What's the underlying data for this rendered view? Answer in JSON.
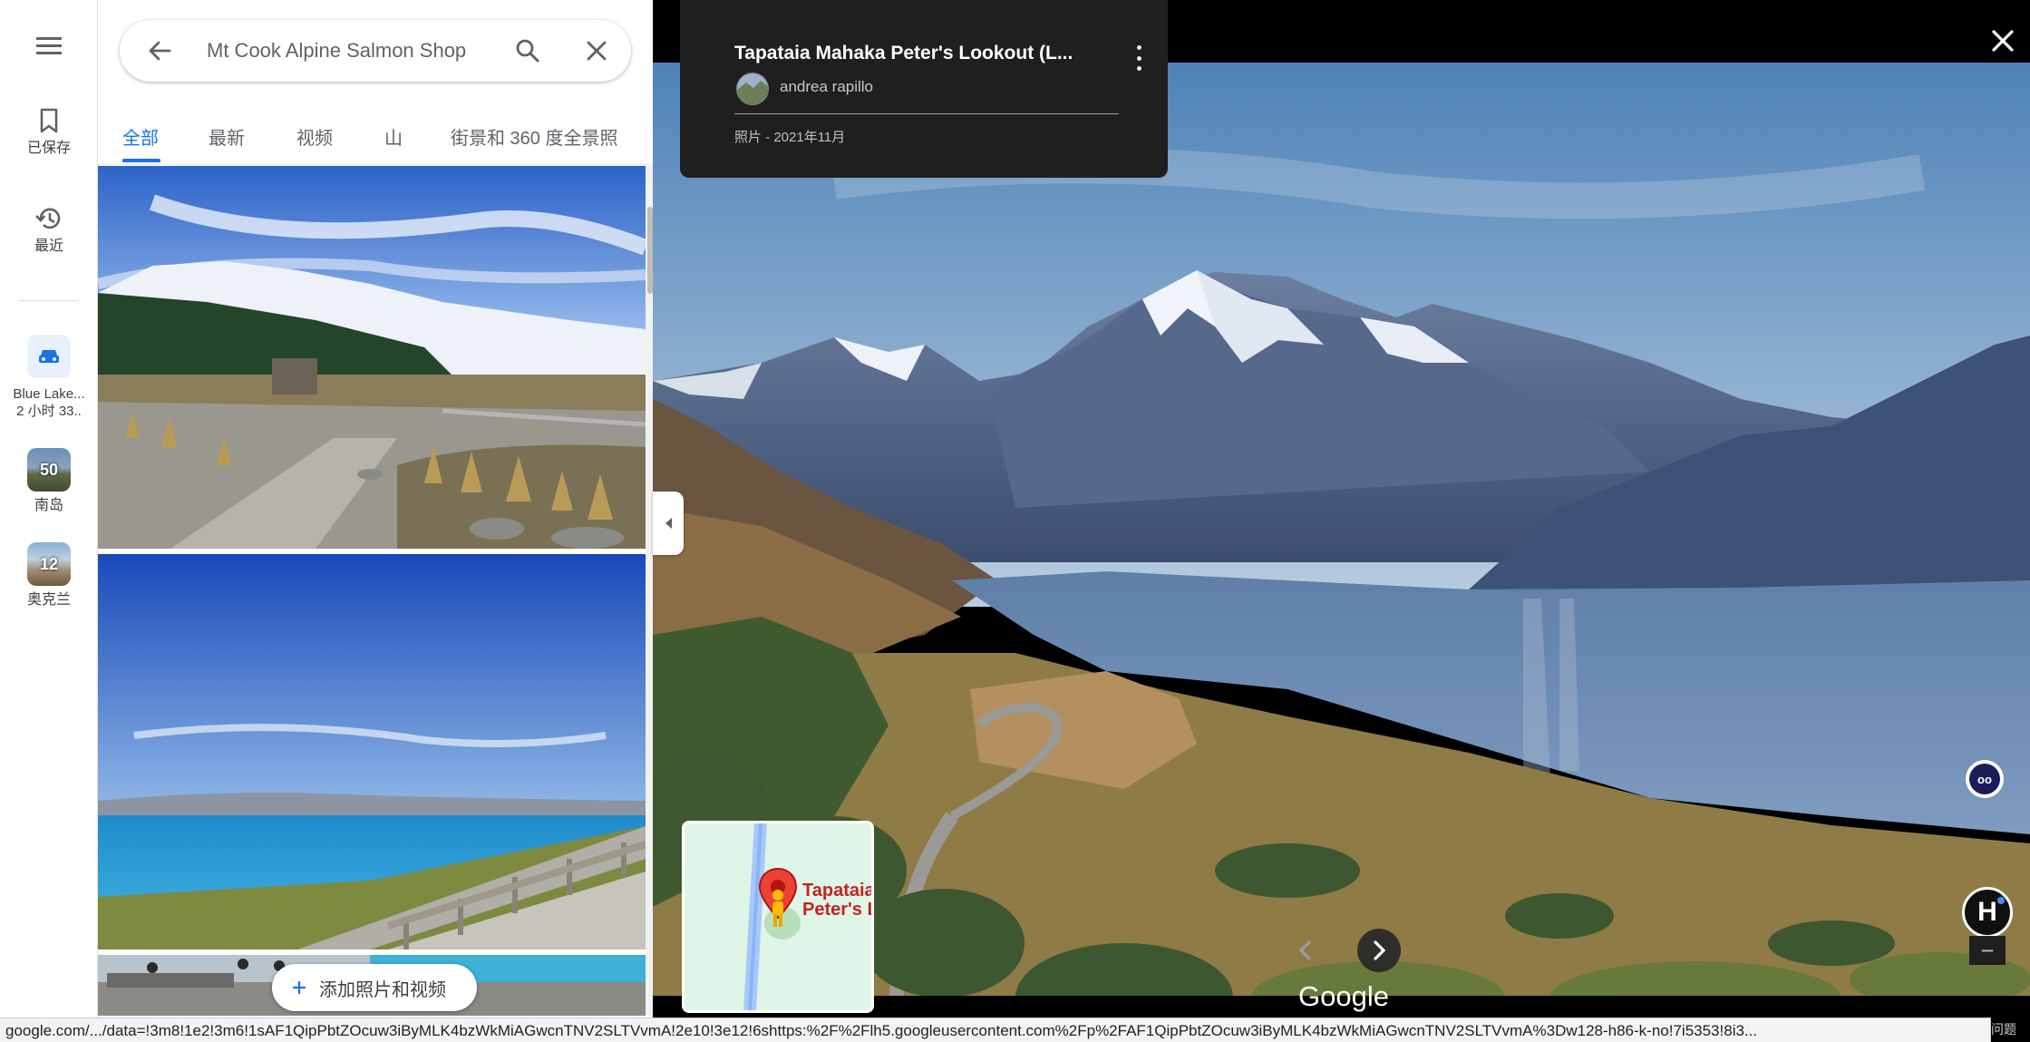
{
  "rail": {
    "saved_label": "已保存",
    "recent_label": "最近",
    "trip_line1": "Blue Lake...",
    "trip_line2": "2 小时 33..",
    "list1_count": "50",
    "list1_label": "南岛",
    "list2_count": "12",
    "list2_label": "奥克兰"
  },
  "search": {
    "query": "Mt Cook Alpine Salmon Shop"
  },
  "tabs": [
    {
      "label": "全部",
      "active": true
    },
    {
      "label": "最新",
      "active": false
    },
    {
      "label": "视频",
      "active": false
    },
    {
      "label": "山",
      "active": false
    },
    {
      "label": "街景和 360 度全景照",
      "active": false
    }
  ],
  "add_photo_label": "添加照片和视频",
  "viewer": {
    "title": "Tapataia Mahaka Peter's Lookout (L...",
    "author": "andrea rapillo",
    "date": "照片 - 2021年11月",
    "minimap_label_line1": "Tapataia",
    "minimap_label_line2": "Peter's L",
    "google_logo": "Google",
    "ext_badge": "oo",
    "ext_h": "H",
    "zoom_minus": "−"
  },
  "status_bar": {
    "url": "google.com/.../data=!3m8!1e2!3m6!1sAF1QipPbtZOcuw3iByMLK4bzWkMiAGwcnTNV2SLTVvmA!2e10!3e12!6shttps:%2F%2Flh5.googleusercontent.com%2Fp%2FAF1QipPbtZOcuw3iByMLK4bzWkMiAGwcnTNV2SLTVvmA%3Dw128-h86-k-no!7i5353!8i3...",
    "tail": "问题"
  },
  "colors": {
    "accent": "#1a73e8",
    "info_card_bg": "#1f1f1f",
    "pin_red": "#ea4335"
  }
}
